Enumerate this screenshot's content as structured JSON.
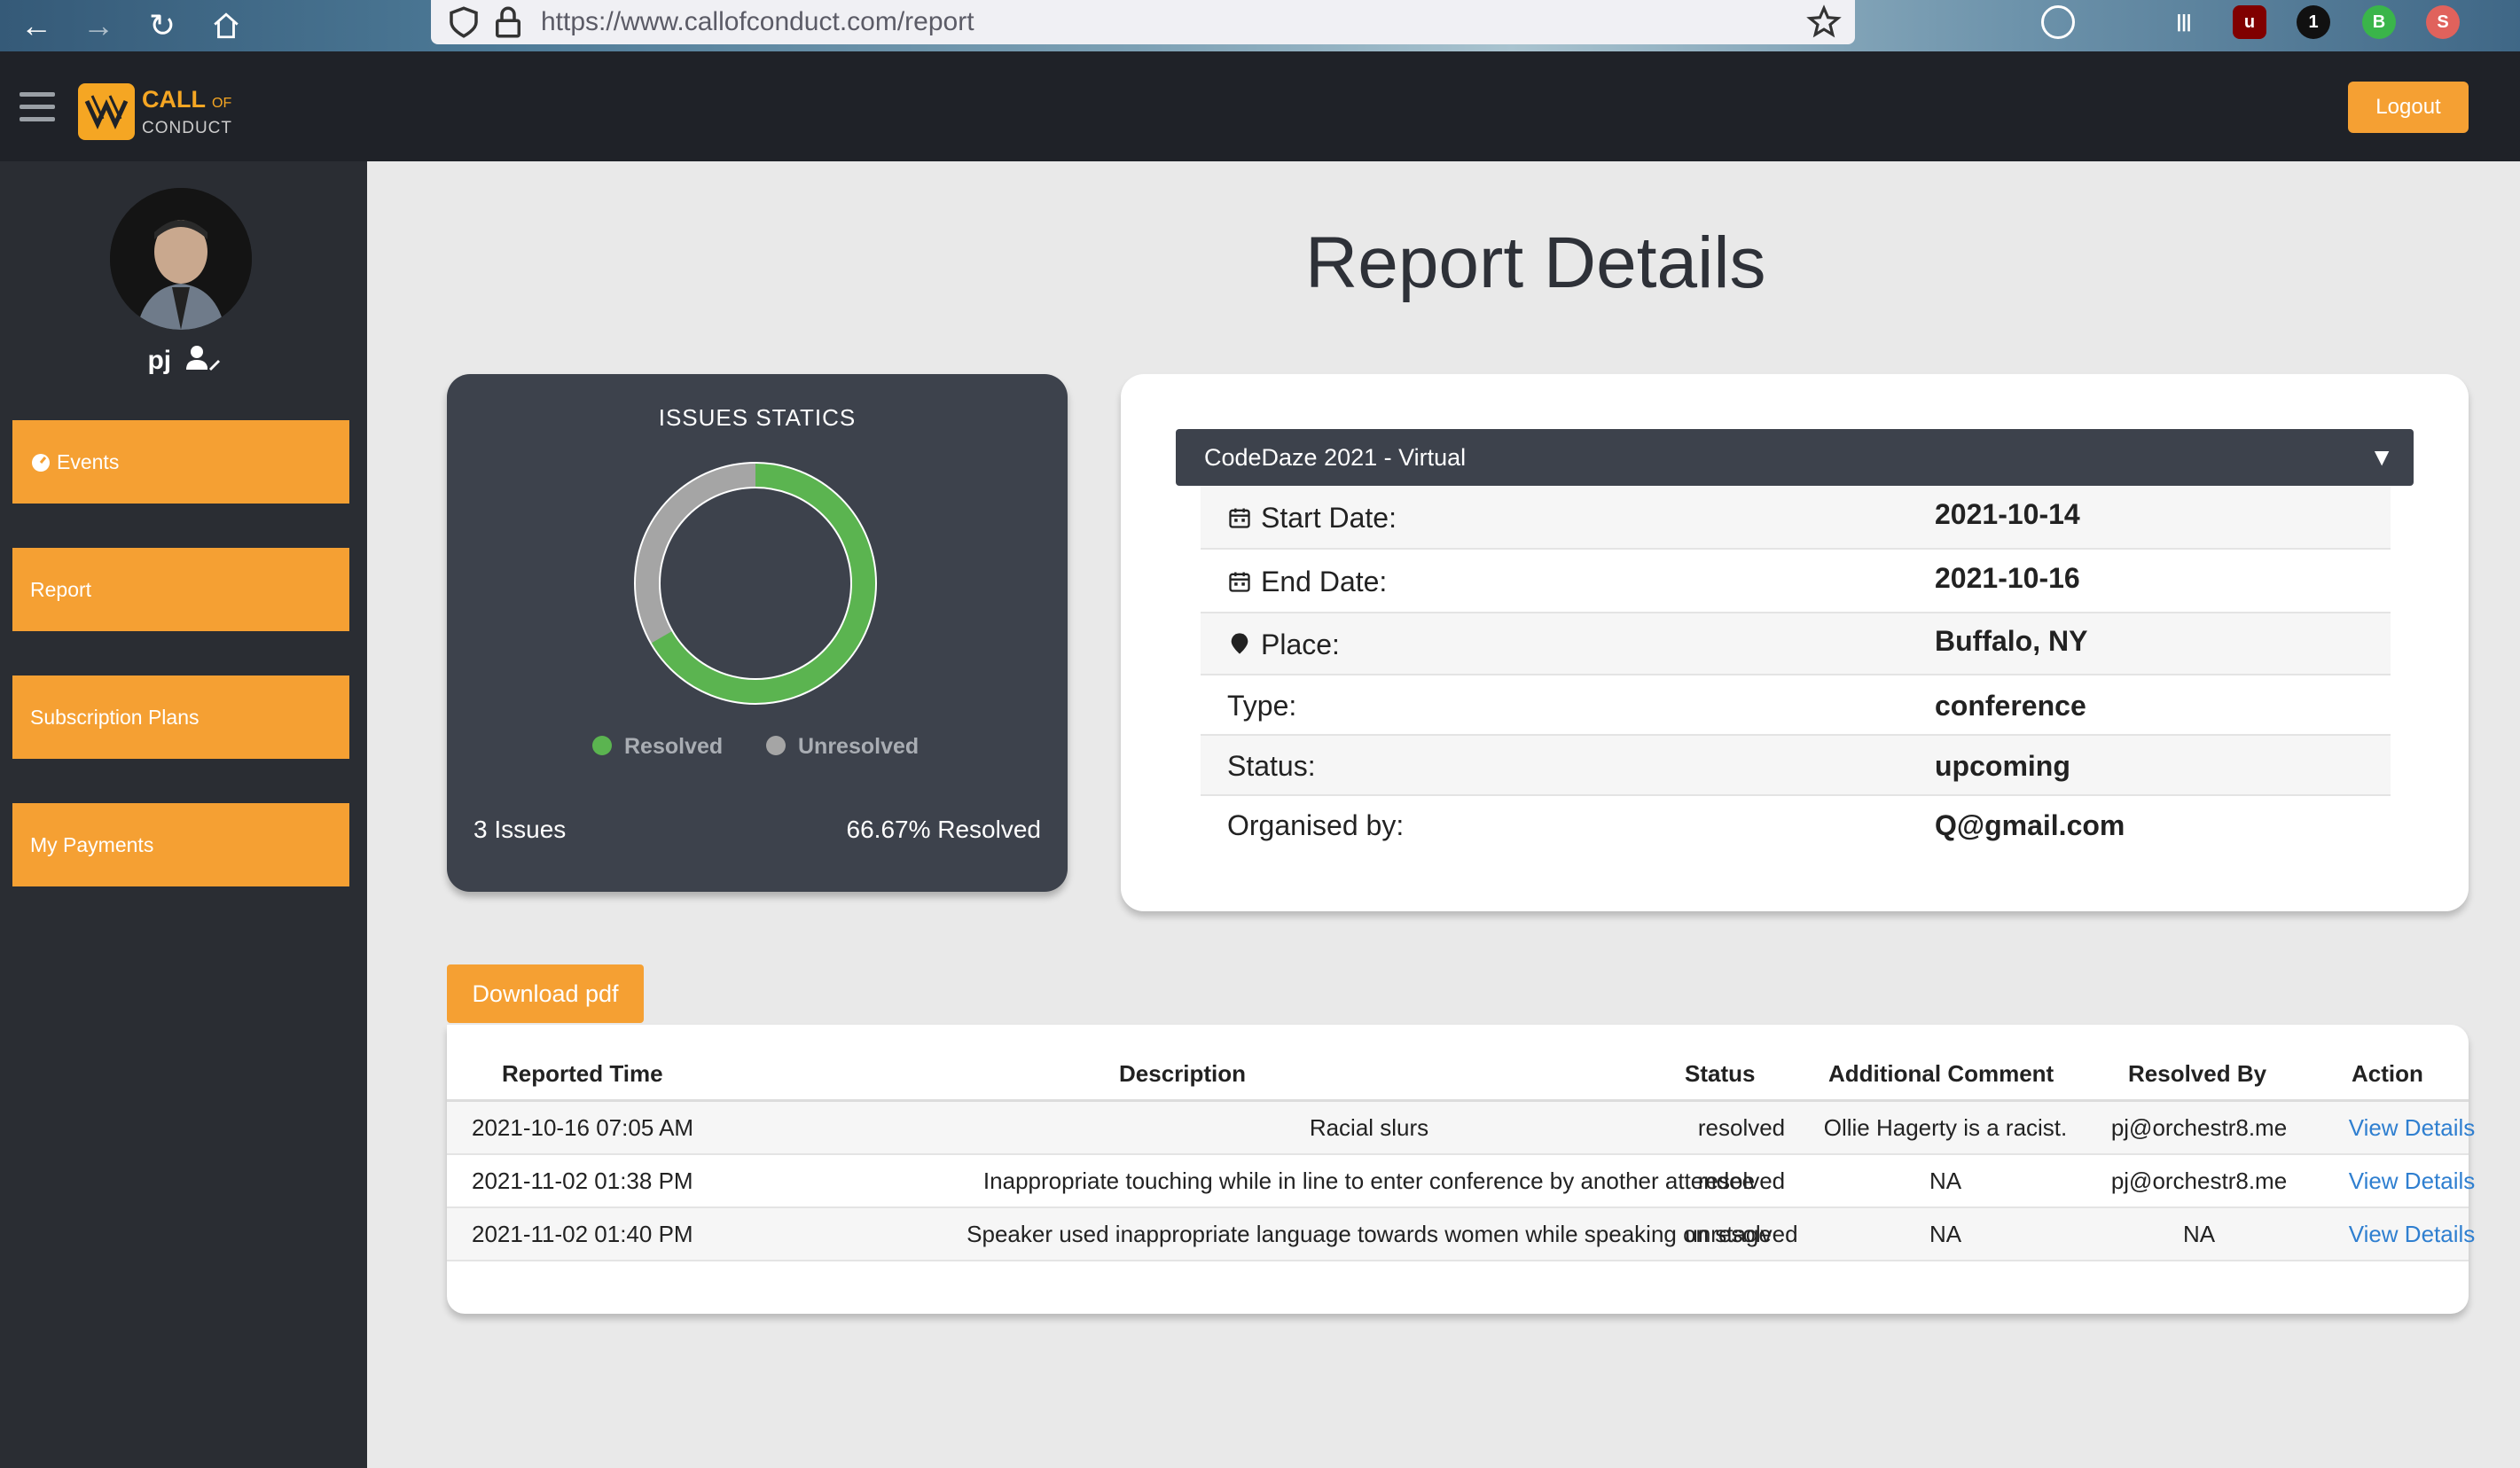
{
  "browser": {
    "url": "https://www.callofconduct.com/report"
  },
  "header": {
    "logo_line1": "CALL",
    "logo_of": "OF",
    "logo_line2": "CONDUCT",
    "logout_label": "Logout"
  },
  "sidebar": {
    "username": "pj",
    "items": [
      {
        "label": "Events"
      },
      {
        "label": "Report"
      },
      {
        "label": "Subscription Plans"
      },
      {
        "label": "My Payments"
      }
    ]
  },
  "page": {
    "title": "Report Details"
  },
  "stats": {
    "title": "ISSUES STATICS",
    "legend_resolved": "Resolved",
    "legend_unresolved": "Unresolved",
    "issues_count": "3 Issues",
    "resolved_pct": "66.67% Resolved",
    "resolved_fraction": 0.6667,
    "colors": {
      "resolved": "#5bb450",
      "unresolved": "#a5a5a5"
    }
  },
  "event": {
    "selected": "CodeDaze 2021 - Virtual",
    "rows": [
      {
        "label": "Start Date:",
        "value": "2021-10-14",
        "icon": "calendar-icon"
      },
      {
        "label": "End Date:",
        "value": "2021-10-16",
        "icon": "calendar-icon"
      },
      {
        "label": "Place:",
        "value": "Buffalo, NY",
        "icon": "map-pin-icon"
      },
      {
        "label": "Type:",
        "value": "conference"
      },
      {
        "label": "Status:",
        "value": "upcoming"
      },
      {
        "label": "Organised by:",
        "value": "Q@gmail.com"
      }
    ]
  },
  "download_label": "Download pdf",
  "table": {
    "headers": [
      "Reported Time",
      "Description",
      "Status",
      "Additional Comment",
      "Resolved By",
      "Action"
    ],
    "rows": [
      {
        "time": "2021-10-16 07:05 AM",
        "description": "Racial slurs",
        "status": "resolved",
        "comment": "Ollie Hagerty is a racist.",
        "resolved_by": "pj@orchestr8.me",
        "action": "View Details"
      },
      {
        "time": "2021-11-02 01:38 PM",
        "description": "Inappropriate touching while in line to enter conference by another attendee",
        "status": "resolved",
        "comment": "NA",
        "resolved_by": "pj@orchestr8.me",
        "action": "View Details"
      },
      {
        "time": "2021-11-02 01:40 PM",
        "description": "Speaker used inappropriate language towards women while speaking on stage",
        "status": "unresolved",
        "comment": "NA",
        "resolved_by": "NA",
        "action": "View Details"
      }
    ]
  }
}
